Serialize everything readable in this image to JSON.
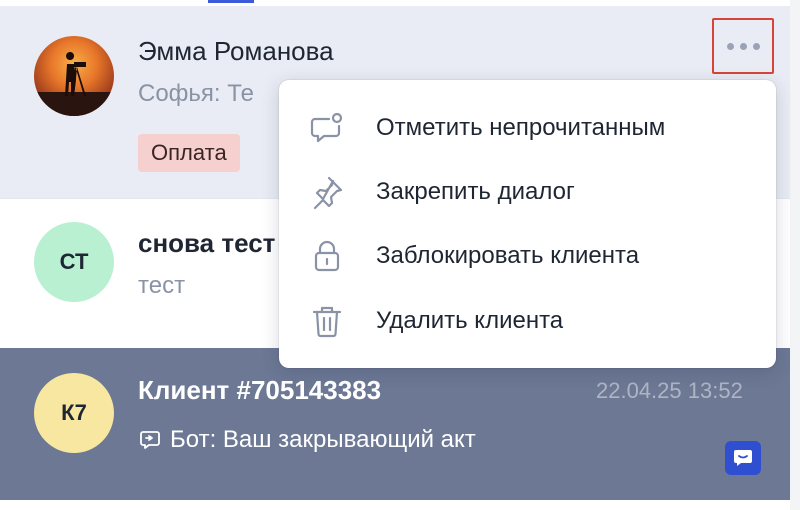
{
  "conversations": [
    {
      "name": "Эмма Романова",
      "preview": "Софья: Те",
      "tag": "Оплата",
      "avatar": "photo"
    },
    {
      "name": "снова тест",
      "preview": "тест",
      "initials": "СТ"
    },
    {
      "name": "Клиент #705143383",
      "time": "22.04.25 13:52",
      "preview": "Бот: Ваш закрывающий акт",
      "initials": "К7"
    }
  ],
  "context_menu": {
    "items": [
      {
        "label": "Отметить непрочитанным",
        "icon": "unread-message-icon"
      },
      {
        "label": "Закрепить диалог",
        "icon": "pin-icon"
      },
      {
        "label": "Заблокировать клиента",
        "icon": "lock-icon"
      },
      {
        "label": "Удалить клиента",
        "icon": "trash-icon"
      }
    ]
  },
  "colors": {
    "accent": "#3b5bdb",
    "selected_row": "#6c7894",
    "highlight_border": "#d8443a",
    "tag_background": "#f6cfcf"
  }
}
